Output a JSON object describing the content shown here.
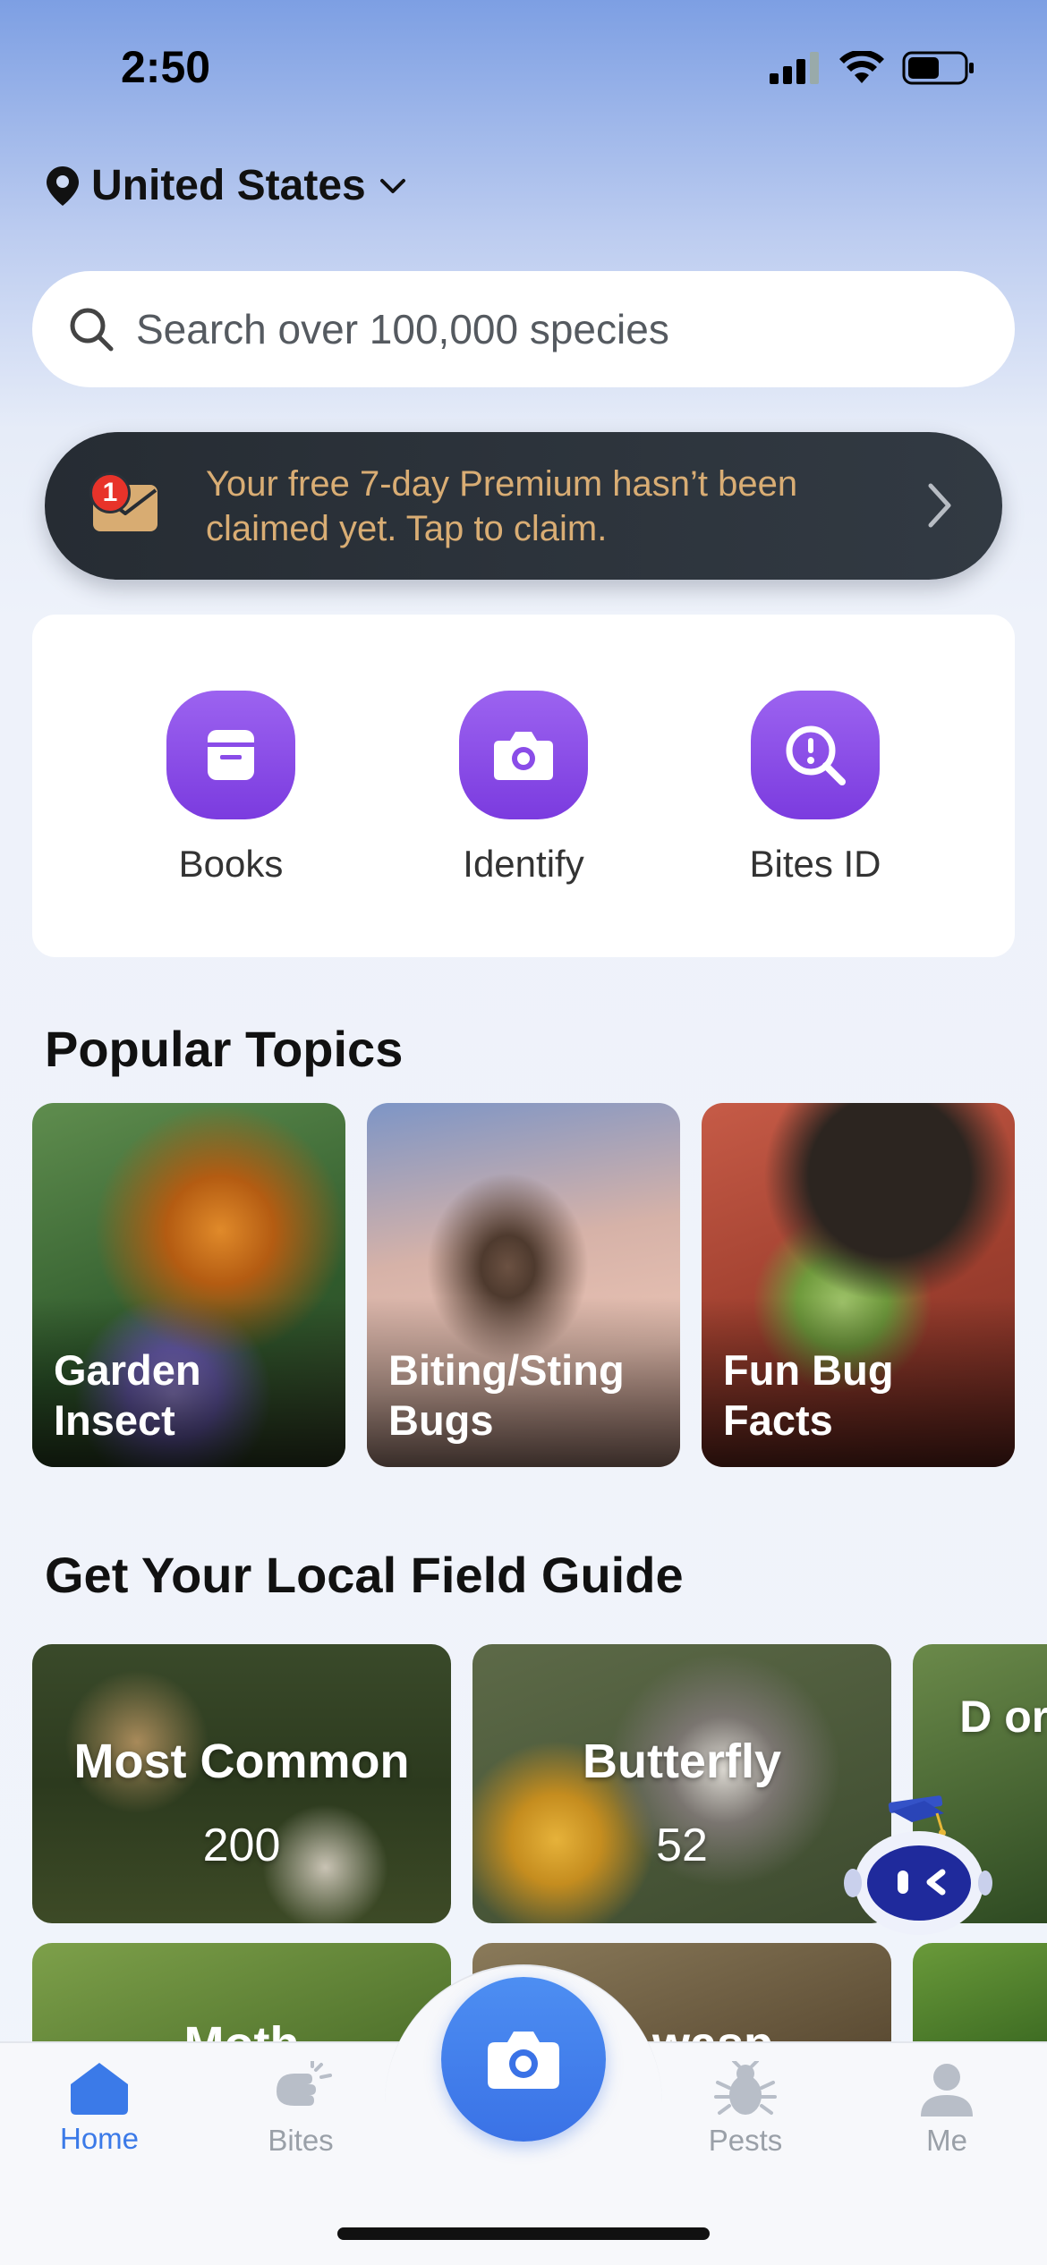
{
  "status_bar": {
    "time": "2:50"
  },
  "location": {
    "label": "United States"
  },
  "search": {
    "placeholder": "Search over 100,000 species"
  },
  "promo": {
    "badge_count": "1",
    "text": "Your free 7-day Premium hasn’t been claimed yet. Tap to claim."
  },
  "quick_actions": [
    {
      "label": "Books",
      "icon": "book-icon"
    },
    {
      "label": "Identify",
      "icon": "camera-icon"
    },
    {
      "label": "Bites ID",
      "icon": "bite-search-icon"
    }
  ],
  "popular_topics": {
    "title": "Popular Topics",
    "items": [
      {
        "label": "Garden Insect"
      },
      {
        "label": "Biting/Sting Bugs"
      },
      {
        "label": "Fun Bug Facts"
      }
    ]
  },
  "field_guide": {
    "title": "Get Your Local Field Guide",
    "items": [
      {
        "name": "Most Common",
        "count": "200"
      },
      {
        "name": "Butterfly",
        "count": "52"
      },
      {
        "name": "D or I"
      }
    ],
    "row2": [
      {
        "name": "Moth"
      },
      {
        "name": "or wasp"
      }
    ]
  },
  "tabbar": {
    "tabs": [
      {
        "label": "Home",
        "active": true
      },
      {
        "label": "Bites",
        "active": false
      },
      {
        "label": "Pests",
        "active": false
      },
      {
        "label": "Me",
        "active": false
      }
    ]
  },
  "colors": {
    "accent": "#3b7ae8",
    "purple": "#8a4ce8",
    "promo_text": "#d9ad74",
    "badge": "#e8332a"
  }
}
